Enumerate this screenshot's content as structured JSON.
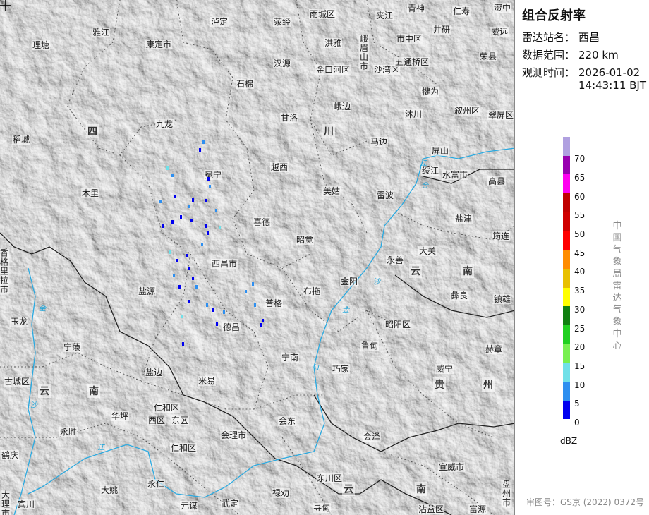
{
  "panel": {
    "title": "组合反射率",
    "station_label": "雷达站名：",
    "station_value": "西昌",
    "range_label": "数据范围：",
    "range_value": "220 km",
    "time_label": "观测时间：",
    "time_date": "2026-01-02",
    "time_clock": "14:43:11 BJT",
    "unit": "dBZ",
    "org": "中国气象局雷达气象中心",
    "copyright": "审图号：GS京 (2022) 0372号"
  },
  "legend": {
    "colors": [
      "#0000f0",
      "#2e8ff0",
      "#70e0e8",
      "#78f050",
      "#20d020",
      "#108010",
      "#ffff00",
      "#e8c000",
      "#ff8c00",
      "#ff0000",
      "#d00000",
      "#c00000",
      "#ff00f0",
      "#9800b0",
      "#b0a0e0"
    ],
    "ticks": [
      "0",
      "5",
      "10",
      "15",
      "20",
      "25",
      "30",
      "35",
      "40",
      "45",
      "50",
      "55",
      "60",
      "65",
      "70"
    ]
  },
  "map": {
    "places": [
      {
        "name": "雅江"
      },
      {
        "name": "理塘"
      },
      {
        "name": "康定市"
      },
      {
        "name": "泸定"
      },
      {
        "name": "荥经"
      },
      {
        "name": "雨城区"
      },
      {
        "name": "夹江"
      },
      {
        "name": "青神"
      },
      {
        "name": "仁寿"
      },
      {
        "name": "资中"
      },
      {
        "name": "洪雅"
      },
      {
        "name": "峨眉山市"
      },
      {
        "name": "市中区"
      },
      {
        "name": "井研"
      },
      {
        "name": "威远"
      },
      {
        "name": "汉源"
      },
      {
        "name": "金口河区"
      },
      {
        "name": "沙湾区"
      },
      {
        "name": "五通桥区"
      },
      {
        "name": "荣县"
      },
      {
        "name": "石棉"
      },
      {
        "name": "犍为"
      },
      {
        "name": "九龙"
      },
      {
        "name": "甘洛"
      },
      {
        "name": "峨边"
      },
      {
        "name": "沐川"
      },
      {
        "name": "叙州区"
      },
      {
        "name": "翠屏区"
      },
      {
        "name": "稻城"
      },
      {
        "name": "马边"
      },
      {
        "name": "屏山"
      },
      {
        "name": "绥江"
      },
      {
        "name": "水富市"
      },
      {
        "name": "高县"
      },
      {
        "name": "冕宁"
      },
      {
        "name": "越西"
      },
      {
        "name": "木里"
      },
      {
        "name": "美姑"
      },
      {
        "name": "雷波"
      },
      {
        "name": "盐津"
      },
      {
        "name": "喜德"
      },
      {
        "name": "昭觉"
      },
      {
        "name": "筠连"
      },
      {
        "name": "香格里拉市"
      },
      {
        "name": "西昌市"
      },
      {
        "name": "大关"
      },
      {
        "name": "永善"
      },
      {
        "name": "盐源"
      },
      {
        "name": "布拖"
      },
      {
        "name": "金阳"
      },
      {
        "name": "彝良"
      },
      {
        "name": "镇雄"
      },
      {
        "name": "普格"
      },
      {
        "name": "玉龙"
      },
      {
        "name": "德昌"
      },
      {
        "name": "昭阳区"
      },
      {
        "name": "宁蒗"
      },
      {
        "name": "鲁甸"
      },
      {
        "name": "赫章"
      },
      {
        "name": "宁南"
      },
      {
        "name": "巧家"
      },
      {
        "name": "盐边"
      },
      {
        "name": "威宁"
      },
      {
        "name": "古城区"
      },
      {
        "name": "米易"
      },
      {
        "name": "仁和区"
      },
      {
        "name": "华坪"
      },
      {
        "name": "西区"
      },
      {
        "name": "东区"
      },
      {
        "name": "永胜"
      },
      {
        "name": "会东"
      },
      {
        "name": "会理市"
      },
      {
        "name": "会泽"
      },
      {
        "name": "仁和区"
      },
      {
        "name": "鹤庆"
      },
      {
        "name": "宣威市"
      },
      {
        "name": "永仁"
      },
      {
        "name": "东川区"
      },
      {
        "name": "大姚"
      },
      {
        "name": "盘州市"
      },
      {
        "name": "宾川"
      },
      {
        "name": "元谋"
      },
      {
        "name": "武定"
      },
      {
        "name": "禄劝"
      },
      {
        "name": "寻甸"
      },
      {
        "name": "沾益区"
      },
      {
        "name": "富源"
      },
      {
        "name": "大理市"
      }
    ],
    "regions": [
      {
        "name": "四"
      },
      {
        "name": "川"
      },
      {
        "name": "云"
      },
      {
        "name": "南"
      },
      {
        "name": "云"
      },
      {
        "name": "南"
      },
      {
        "name": "贵"
      },
      {
        "name": "州"
      },
      {
        "name": "云"
      },
      {
        "name": "南"
      }
    ],
    "rivers": [
      {
        "name": "金"
      },
      {
        "name": "金"
      },
      {
        "name": "江"
      },
      {
        "name": "沙"
      },
      {
        "name": "江"
      },
      {
        "name": "沙"
      },
      {
        "name": "江"
      },
      {
        "name": "金"
      }
    ]
  }
}
